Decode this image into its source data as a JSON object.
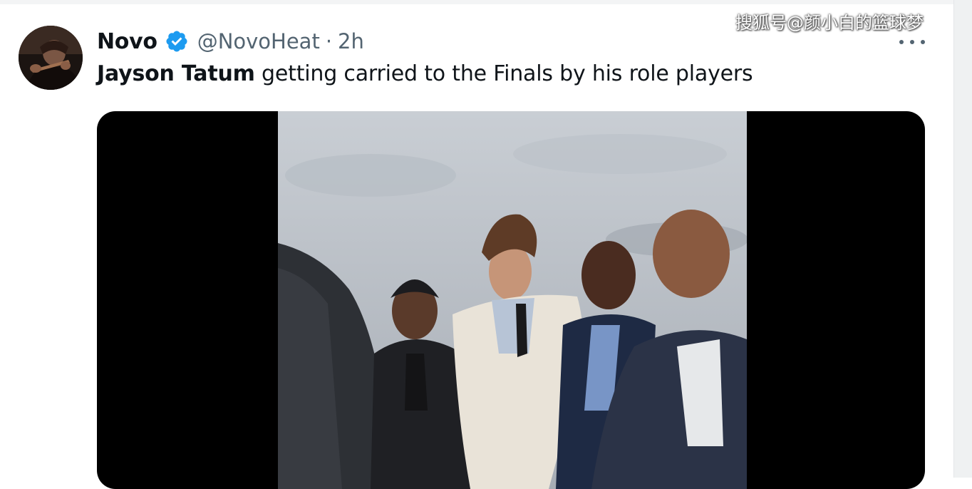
{
  "watermark": "搜狐号@颜小白的篮球梦",
  "tweet": {
    "author_name": "Novo",
    "handle": "@NovoHeat",
    "separator": "·",
    "time": "2h",
    "text_mention": "Jayson Tatum",
    "text_rest": " getting carried to the Finals by his role players"
  },
  "icons": {
    "verified": "verified-badge-icon",
    "more": "more-options-icon"
  },
  "colors": {
    "text_primary": "#0f1419",
    "text_secondary": "#536471",
    "verified_blue": "#1d9bf0",
    "media_background": "#000000"
  }
}
